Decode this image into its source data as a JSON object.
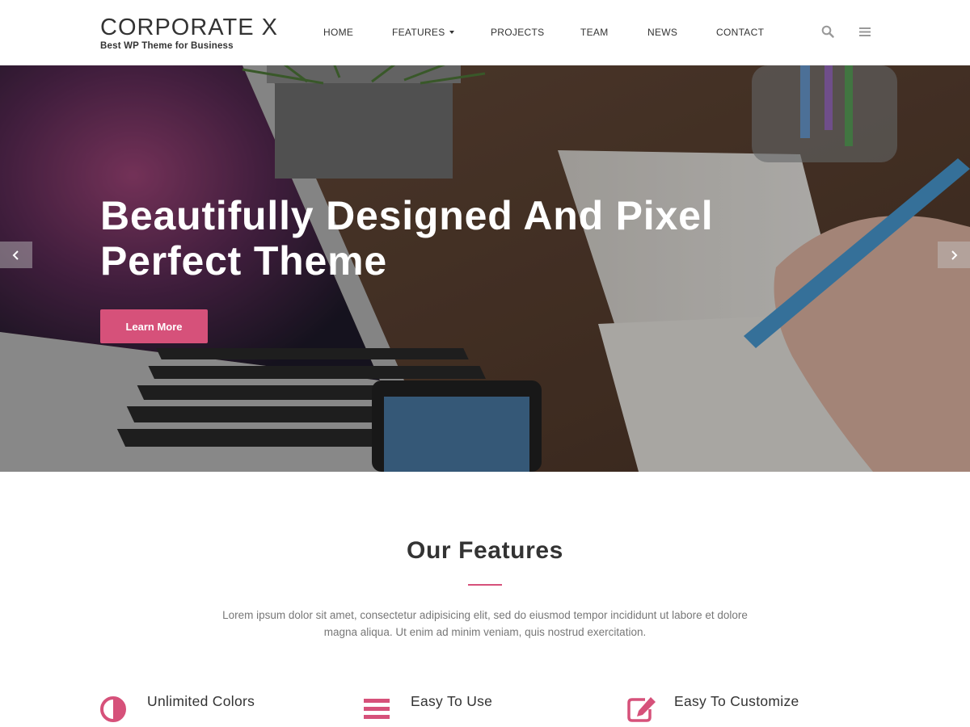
{
  "site": {
    "title": "CORPORATE X",
    "tagline": "Best WP Theme for Business"
  },
  "nav": {
    "items": [
      {
        "label": "HOME"
      },
      {
        "label": "FEATURES"
      },
      {
        "label": "PROJECTS"
      },
      {
        "label": "TEAM"
      },
      {
        "label": "NEWS"
      },
      {
        "label": "CONTACT"
      }
    ],
    "icons": [
      "search-icon",
      "menu-icon",
      "chevron-down-icon"
    ]
  },
  "hero": {
    "title": "Beautifully Designed And Pixel Perfect Theme",
    "button_label": "Learn More",
    "icons": [
      "chevron-left-icon",
      "chevron-right-icon"
    ]
  },
  "features": {
    "title": "Our Features",
    "description": "Lorem ipsum dolor sit amet, consectetur adipisicing elit, sed do eiusmod tempor incididunt ut labore et dolore magna aliqua. Ut enim ad minim veniam, quis nostrud exercitation.",
    "items": [
      {
        "title": "Unlimited Colors",
        "icon": "adjust-icon"
      },
      {
        "title": "Easy To Use",
        "icon": "bars-icon"
      },
      {
        "title": "Easy To Customize",
        "icon": "edit-icon"
      }
    ]
  },
  "colors": {
    "accent": "#d6517a",
    "text": "#333333",
    "muted": "#777777"
  }
}
